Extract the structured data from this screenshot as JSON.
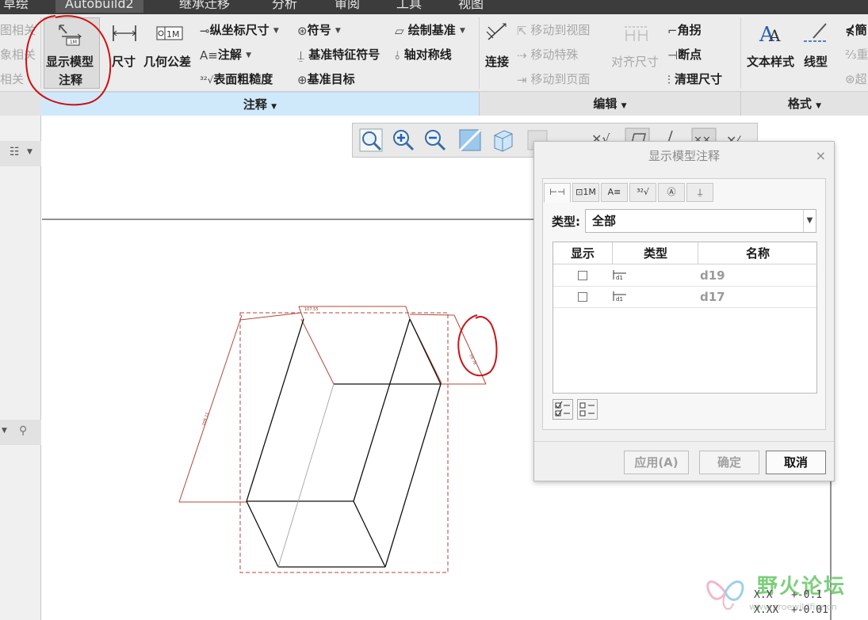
{
  "menu": {
    "tabs": [
      "草绘",
      "Autobuild2",
      "继承迁移",
      "分析",
      "审阅",
      "工具",
      "视图"
    ]
  },
  "ribbon": {
    "left_stub_items": [
      "图相关",
      "象相关",
      "相关"
    ],
    "show_model_annotation": {
      "line1": "显示模型",
      "line2": "注释"
    },
    "dimension": "尺寸",
    "geometric_tolerance": "几何公差",
    "ordinate_dimension": "纵坐标尺寸",
    "note": "注解",
    "surface_finish": "表面粗糙度",
    "symbol": "符号",
    "datum_feature_symbol": "基准特征符号",
    "datum_target": "基准目标",
    "draw_datum": "绘制基准",
    "axis_of_symmetry": "轴对称线",
    "annotation_group": "注释",
    "connect": "连接",
    "move_to_view": "移动到视图",
    "move_special": "移动特殊",
    "move_to_page": "移动到页面",
    "align_dimensions": "对齐尺寸",
    "jog": "角拐",
    "break": "断点",
    "cleanup_dimensions": "清理尺寸",
    "edit_group": "编辑",
    "text_style": "文本样式",
    "line_style": "线型",
    "format_group": "格式"
  },
  "drawing": {
    "dim_top": "107.55",
    "dim_left": "209.11",
    "dim_right": "59.76"
  },
  "dialog": {
    "title": "显示模型注释",
    "close": "×",
    "tab_icons": [
      "dimension-tab-icon",
      "gtol-tab-icon",
      "note-tab-icon",
      "surface-finish-tab-icon",
      "symbol-tab-icon",
      "datum-tab-icon"
    ],
    "type_label": "类型:",
    "type_value": "全部",
    "columns": [
      "显示",
      "类型",
      "名称"
    ],
    "rows": [
      {
        "show": false,
        "name": "d19"
      },
      {
        "show": false,
        "name": "d17"
      }
    ],
    "apply": "应用(A)",
    "ok": "确定",
    "cancel": "取消"
  },
  "watermark": {
    "title": "野火论坛",
    "url": "www.proewildfire.cn",
    "tol_line1": "X.X   +-0.1",
    "tol_line2": "X.XX  +-0.01"
  },
  "colors": {
    "annotation_red": "#cc1111",
    "ribbon_highlight": "#cfe9fb",
    "dim_line": "#b04a3a"
  }
}
